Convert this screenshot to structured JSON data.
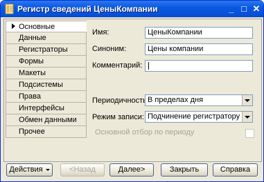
{
  "window": {
    "title": "Регистр сведений ЦеныКомпании"
  },
  "sidebar": {
    "items": [
      {
        "label": "Основные",
        "active": true
      },
      {
        "label": "Данные"
      },
      {
        "label": "Регистраторы"
      },
      {
        "label": "Формы"
      },
      {
        "label": "Макеты"
      },
      {
        "label": "Подсистемы"
      },
      {
        "label": "Права"
      },
      {
        "label": "Интерфейсы"
      },
      {
        "label": "Обмен данными"
      },
      {
        "label": "Прочее"
      }
    ]
  },
  "form": {
    "name_label": "Имя:",
    "name_value": "ЦеныКомпании",
    "synonym_label": "Синоним:",
    "synonym_value": "Цены компании",
    "comment_label": "Комментарий:",
    "comment_value": "",
    "periodicity_label": "Периодичность:",
    "periodicity_value": "В пределах дня",
    "write_mode_label": "Режим записи:",
    "write_mode_value": "Подчинение регистратору",
    "main_filter_label": "Основной отбор по периоду",
    "main_filter_checked": false
  },
  "buttons": {
    "actions": "Действия",
    "back": "<Назад",
    "next": "Далее>",
    "close": "Закрыть",
    "help": "Справка"
  },
  "titlebar_buttons": {
    "minimize": "_",
    "maximize": "□",
    "close": "✕"
  }
}
